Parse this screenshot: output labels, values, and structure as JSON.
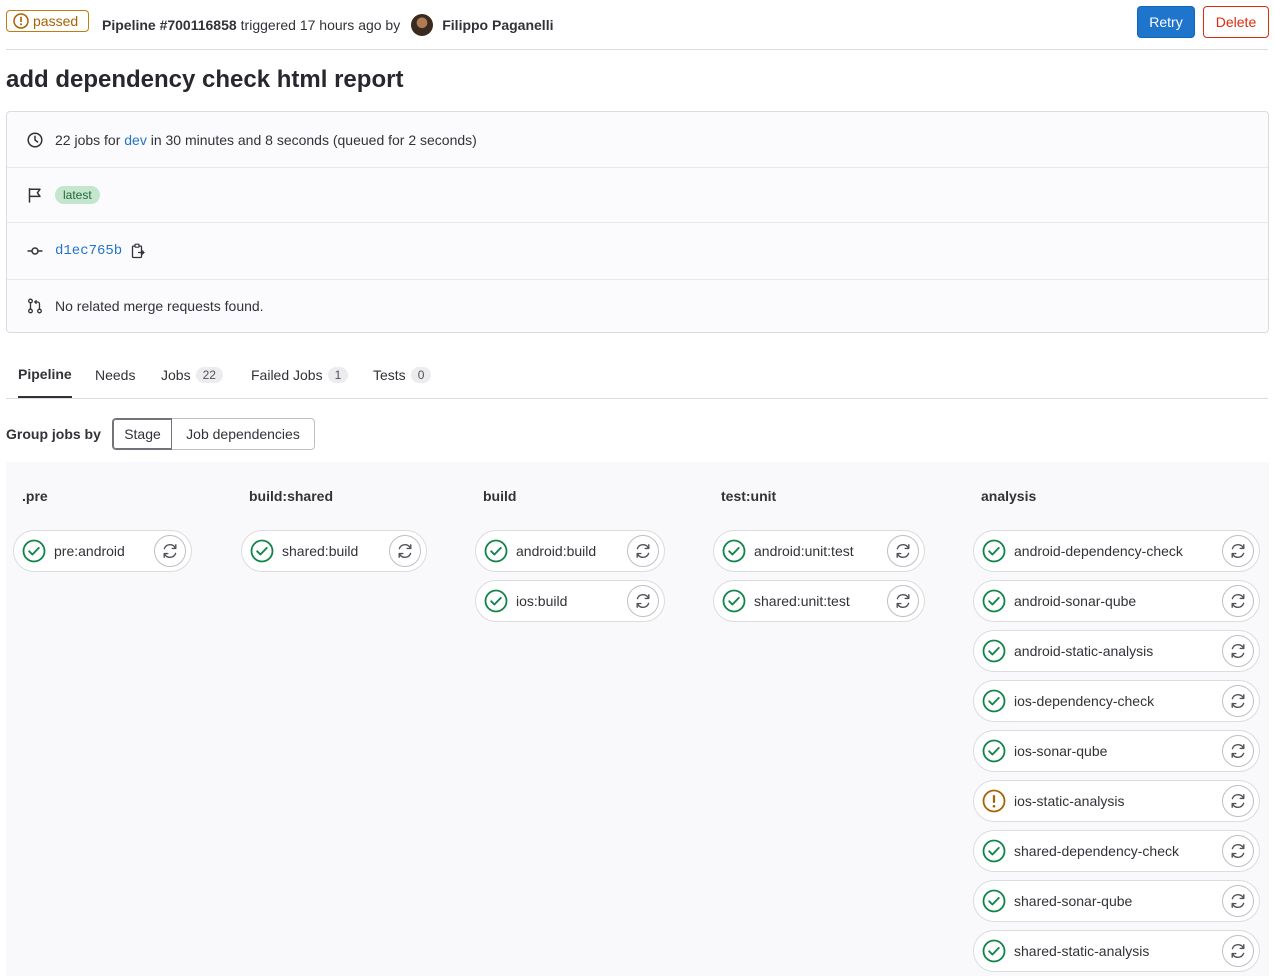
{
  "header": {
    "status": "passed",
    "pipeline_id": "Pipeline #700116858",
    "triggered_text": "triggered 17 hours ago by",
    "user_name": "Filippo Paganelli",
    "retry_label": "Retry",
    "delete_label": "Delete"
  },
  "title": "add dependency check html report",
  "info": {
    "jobs_prefix": "22 jobs for ",
    "branch": "dev",
    "duration": " in 30 minutes and 8 seconds (queued for 2 seconds)",
    "badge": "latest",
    "commit": "d1ec765b",
    "merge_requests": "No related merge requests found."
  },
  "tabs": {
    "pipeline": "Pipeline",
    "needs": "Needs",
    "jobs": "Jobs",
    "jobs_count": "22",
    "failed": "Failed Jobs",
    "failed_count": "1",
    "tests": "Tests",
    "tests_count": "0"
  },
  "grouping": {
    "label": "Group jobs by",
    "stage": "Stage",
    "deps": "Job dependencies"
  },
  "stages": [
    {
      "name": ".pre",
      "jobs": [
        {
          "name": "pre:android",
          "status": "success"
        }
      ]
    },
    {
      "name": "build:shared",
      "jobs": [
        {
          "name": "shared:build",
          "status": "success"
        }
      ]
    },
    {
      "name": "build",
      "jobs": [
        {
          "name": "android:build",
          "status": "success"
        },
        {
          "name": "ios:build",
          "status": "success"
        }
      ]
    },
    {
      "name": "test:unit",
      "jobs": [
        {
          "name": "android:unit:test",
          "status": "success"
        },
        {
          "name": "shared:unit:test",
          "status": "success"
        }
      ]
    },
    {
      "name": "analysis",
      "jobs": [
        {
          "name": "android-dependency-check",
          "status": "success"
        },
        {
          "name": "android-sonar-qube",
          "status": "success"
        },
        {
          "name": "android-static-analysis",
          "status": "success"
        },
        {
          "name": "ios-dependency-check",
          "status": "success"
        },
        {
          "name": "ios-sonar-qube",
          "status": "success"
        },
        {
          "name": "ios-static-analysis",
          "status": "warning"
        },
        {
          "name": "shared-dependency-check",
          "status": "success"
        },
        {
          "name": "shared-sonar-qube",
          "status": "success"
        },
        {
          "name": "shared-static-analysis",
          "status": "success"
        }
      ]
    }
  ],
  "colors": {
    "success": "#108548",
    "warning": "#ab6100",
    "primary": "#1f75cb",
    "danger": "#dd2b0e"
  }
}
